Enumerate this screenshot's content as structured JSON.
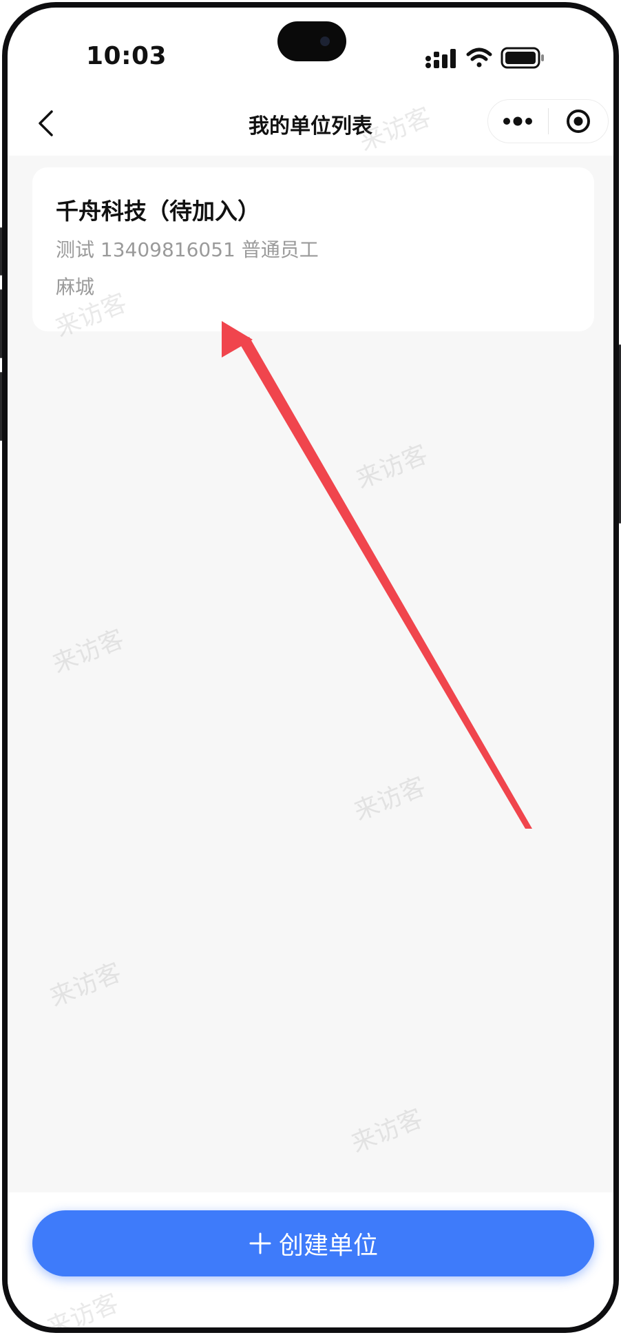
{
  "status_bar": {
    "time": "10:03"
  },
  "nav": {
    "title": "我的单位列表",
    "icons": [
      "back-chevron-icon",
      "more-dots-icon",
      "target-circle-icon"
    ]
  },
  "unit_list": [
    {
      "name": "千舟科技（待加入）",
      "detail": "测试 13409816051 普通员工",
      "city": "麻城"
    }
  ],
  "bottom": {
    "create_label": "创建单位",
    "create_icon": "plus-icon"
  },
  "watermark_text": "来访客",
  "colors": {
    "primary": "#3e7bfa",
    "annotation_arrow": "#f0454d",
    "background": "#f7f7f7"
  }
}
